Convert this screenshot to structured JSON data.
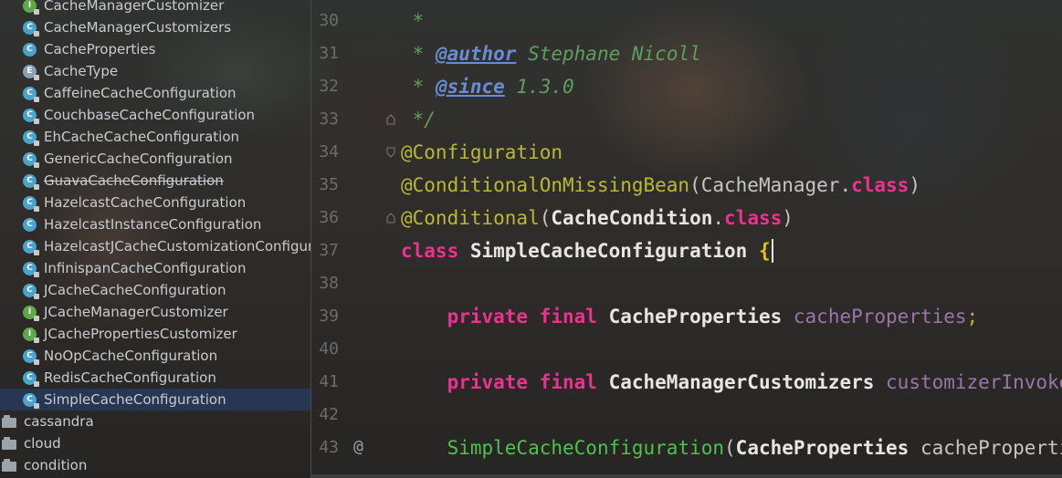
{
  "tree": {
    "items": [
      {
        "label": "CacheManagerCustomizer",
        "icon": "interface-icon",
        "kind": "i",
        "lock": true
      },
      {
        "label": "CacheManagerCustomizers",
        "icon": "class-icon",
        "kind": "c",
        "lock": true
      },
      {
        "label": "CacheProperties",
        "icon": "class-icon",
        "kind": "c",
        "lock": false
      },
      {
        "label": "CacheType",
        "icon": "enum-icon",
        "kind": "e",
        "lock": true
      },
      {
        "label": "CaffeineCacheConfiguration",
        "icon": "class-icon",
        "kind": "c",
        "lock": true
      },
      {
        "label": "CouchbaseCacheConfiguration",
        "icon": "class-icon",
        "kind": "c",
        "lock": true
      },
      {
        "label": "EhCacheCacheConfiguration",
        "icon": "class-icon",
        "kind": "c",
        "lock": true
      },
      {
        "label": "GenericCacheConfiguration",
        "icon": "class-icon",
        "kind": "c",
        "lock": true
      },
      {
        "label": "GuavaCacheConfiguration",
        "icon": "class-icon",
        "kind": "c",
        "lock": true,
        "strike": true
      },
      {
        "label": "HazelcastCacheConfiguration",
        "icon": "class-icon",
        "kind": "c",
        "lock": true
      },
      {
        "label": "HazelcastInstanceConfiguration",
        "icon": "class-icon",
        "kind": "c",
        "lock": false
      },
      {
        "label": "HazelcastJCacheCustomizationConfigura",
        "icon": "class-icon",
        "kind": "c",
        "lock": true
      },
      {
        "label": "InfinispanCacheConfiguration",
        "icon": "class-icon",
        "kind": "c",
        "lock": true
      },
      {
        "label": "JCacheCacheConfiguration",
        "icon": "class-icon",
        "kind": "c",
        "lock": true
      },
      {
        "label": "JCacheManagerCustomizer",
        "icon": "interface-icon",
        "kind": "i",
        "lock": true
      },
      {
        "label": "JCachePropertiesCustomizer",
        "icon": "interface-icon",
        "kind": "i",
        "lock": true
      },
      {
        "label": "NoOpCacheConfiguration",
        "icon": "class-icon",
        "kind": "c",
        "lock": true
      },
      {
        "label": "RedisCacheConfiguration",
        "icon": "class-icon",
        "kind": "c",
        "lock": true
      },
      {
        "label": "SimpleCacheConfiguration",
        "icon": "class-icon",
        "kind": "c",
        "lock": true,
        "selected": true
      }
    ],
    "packages": [
      "cassandra",
      "cloud",
      "condition"
    ]
  },
  "gutter": {
    "line_numbers": [
      "30",
      "31",
      "32",
      "33",
      "34",
      "35",
      "36",
      "37",
      "38",
      "39",
      "40",
      "41",
      "42",
      "43"
    ],
    "override_marker": "@"
  },
  "editor": {
    "lines": [
      {
        "tokens": [
          [
            "doc",
            " *"
          ]
        ]
      },
      {
        "tokens": [
          [
            "doc",
            " * "
          ],
          [
            "doctag",
            "@author"
          ],
          [
            "doc",
            " Stephane Nicoll"
          ]
        ]
      },
      {
        "tokens": [
          [
            "doc",
            " * "
          ],
          [
            "doctag",
            "@since"
          ],
          [
            "doc",
            " 1.3.0"
          ]
        ]
      },
      {
        "tokens": [
          [
            "doc",
            " */"
          ]
        ]
      },
      {
        "tokens": [
          [
            "ann",
            "@Configuration"
          ]
        ]
      },
      {
        "tokens": [
          [
            "ann",
            "@ConditionalOnMissingBean"
          ],
          [
            "plain",
            "("
          ],
          [
            "plain",
            "CacheManager."
          ],
          [
            "kw",
            "class"
          ],
          [
            "plain",
            ")"
          ]
        ]
      },
      {
        "tokens": [
          [
            "ann",
            "@Conditional"
          ],
          [
            "plain",
            "("
          ],
          [
            "cls",
            "CacheCondition"
          ],
          [
            "plain",
            "."
          ],
          [
            "kw",
            "class"
          ],
          [
            "plain",
            ")"
          ]
        ]
      },
      {
        "tokens": [
          [
            "kw",
            "class "
          ],
          [
            "cls",
            "SimpleCacheConfiguration "
          ],
          [
            "brace",
            "{"
          ]
        ],
        "caret": true
      },
      {
        "tokens": []
      },
      {
        "tokens": [
          [
            "plain",
            "    "
          ],
          [
            "kw",
            "private final "
          ],
          [
            "cls",
            "CacheProperties "
          ],
          [
            "field",
            "cacheProperties"
          ],
          [
            "ann",
            ";"
          ]
        ]
      },
      {
        "tokens": []
      },
      {
        "tokens": [
          [
            "plain",
            "    "
          ],
          [
            "kw",
            "private final "
          ],
          [
            "cls",
            "CacheManagerCustomizers "
          ],
          [
            "field",
            "customizerInvoker"
          ],
          [
            "ann",
            ";"
          ]
        ]
      },
      {
        "tokens": []
      },
      {
        "tokens": [
          [
            "plain",
            "    "
          ],
          [
            "method",
            "SimpleCacheConfiguration"
          ],
          [
            "plain",
            "("
          ],
          [
            "cls",
            "CacheProperties "
          ],
          [
            "plain",
            "cacheProperties"
          ]
        ]
      }
    ]
  }
}
